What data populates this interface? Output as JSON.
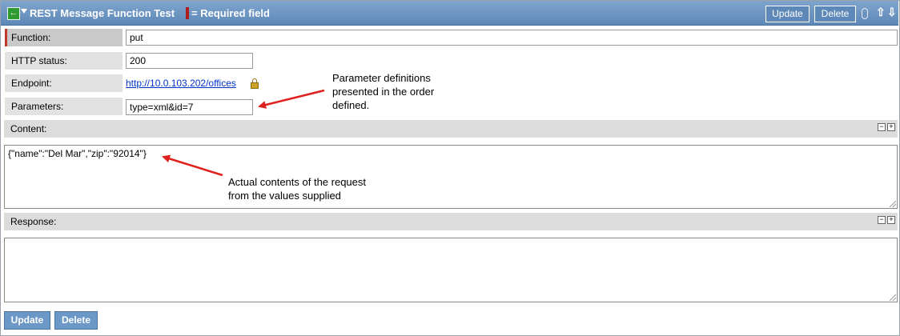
{
  "header": {
    "title": "REST Message Function Test",
    "required_legend": "= Required field",
    "update_label": "Update",
    "delete_label": "Delete",
    "icons": [
      "back-arrow-icon",
      "context-menu-caret-icon",
      "attachment-icon",
      "arrow-up-icon",
      "arrow-down-icon"
    ]
  },
  "form": {
    "function": {
      "label": "Function:",
      "value": "put"
    },
    "http_status": {
      "label": "HTTP status:",
      "value": "200"
    },
    "endpoint": {
      "label": "Endpoint:",
      "value": "http://10.0.103.202/offices"
    },
    "parameters": {
      "label": "Parameters:",
      "value": "type=xml&id=7"
    }
  },
  "content": {
    "label": "Content:",
    "value": "{\"name\":\"Del Mar\",\"zip\":\"92014\"}"
  },
  "response": {
    "label": "Response:",
    "value": ""
  },
  "annotations": {
    "parameters_note": [
      "Parameter definitions",
      "presented in the order",
      "defined."
    ],
    "content_note": [
      "Actual contents of the request",
      "from the values supplied"
    ]
  },
  "footer": {
    "update_label": "Update",
    "delete_label": "Delete"
  },
  "colors": {
    "header_bg": "#6a94c2",
    "required_marker": "#b01c1c",
    "link": "#0033cc",
    "annotation_arrow": "#e0201c"
  }
}
